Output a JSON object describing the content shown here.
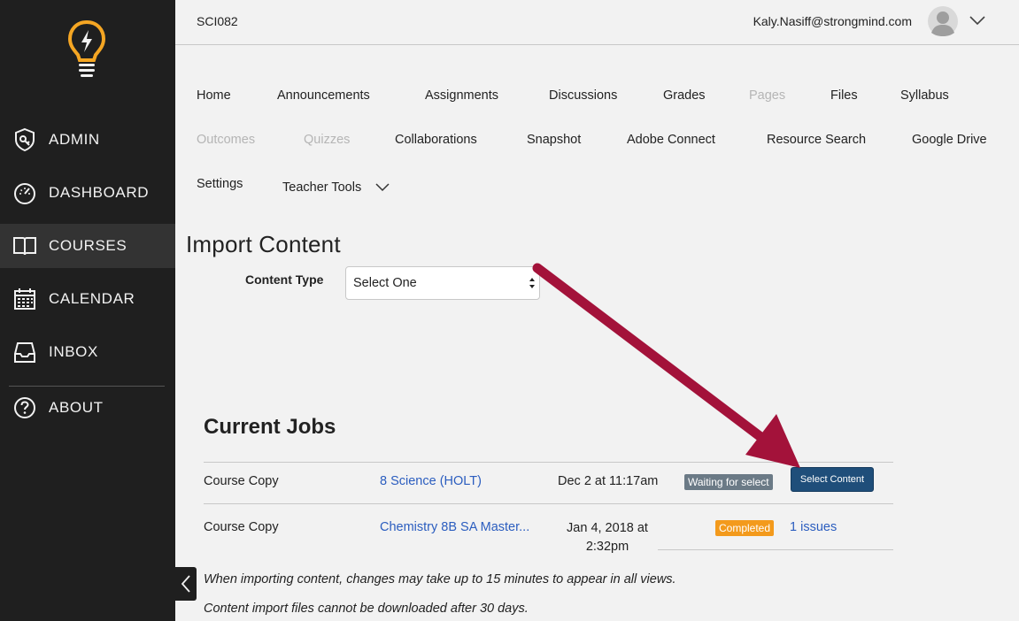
{
  "header": {
    "course_code": "SCI082",
    "user_email": "Kaly.Nasiff@strongmind.com"
  },
  "sidebar": {
    "items": [
      {
        "label": "ADMIN",
        "icon": "shield-icon"
      },
      {
        "label": "DASHBOARD",
        "icon": "speedometer-icon"
      },
      {
        "label": "COURSES",
        "icon": "book-icon",
        "active": true
      },
      {
        "label": "CALENDAR",
        "icon": "calendar-icon"
      },
      {
        "label": "INBOX",
        "icon": "inbox-icon"
      },
      {
        "label": "ABOUT",
        "icon": "question-icon"
      }
    ]
  },
  "course_nav": {
    "home": "Home",
    "announcements": "Announcements",
    "assignments": "Assignments",
    "discussions": "Discussions",
    "grades": "Grades",
    "pages": "Pages",
    "files": "Files",
    "syllabus": "Syllabus",
    "outcomes": "Outcomes",
    "quizzes": "Quizzes",
    "collaborations": "Collaborations",
    "snapshot": "Snapshot",
    "adobe_connect": "Adobe Connect",
    "resource_search": "Resource Search",
    "google_drive": "Google Drive",
    "settings": "Settings",
    "teacher_tools": "Teacher Tools"
  },
  "import": {
    "title": "Import Content",
    "content_type_label": "Content Type",
    "content_type_value": "Select One"
  },
  "jobs": {
    "title": "Current Jobs",
    "rows": [
      {
        "type": "Course Copy",
        "source": "8 Science (HOLT)",
        "date": "Dec 2 at 11:17am",
        "status": "Waiting for select",
        "action": "Select Content"
      },
      {
        "type": "Course Copy",
        "source": "Chemistry 8B SA Master...",
        "date_line1": "Jan 4, 2018 at",
        "date_line2": "2:32pm",
        "status": "Completed",
        "action": "1 issues"
      }
    ]
  },
  "notes": [
    "When importing content, changes may take up to 15 minutes to appear in all views.",
    "Content import files cannot be downloaded after 30 days."
  ],
  "colors": {
    "sidebar_bg": "#1f1f1f",
    "logo_orange": "#f5a623",
    "link_blue": "#2b5dbf",
    "button_blue": "#1f4e7a",
    "badge_waiting": "#6b7a86",
    "badge_completed": "#f39a1c",
    "arrow_red": "#a3123a"
  }
}
